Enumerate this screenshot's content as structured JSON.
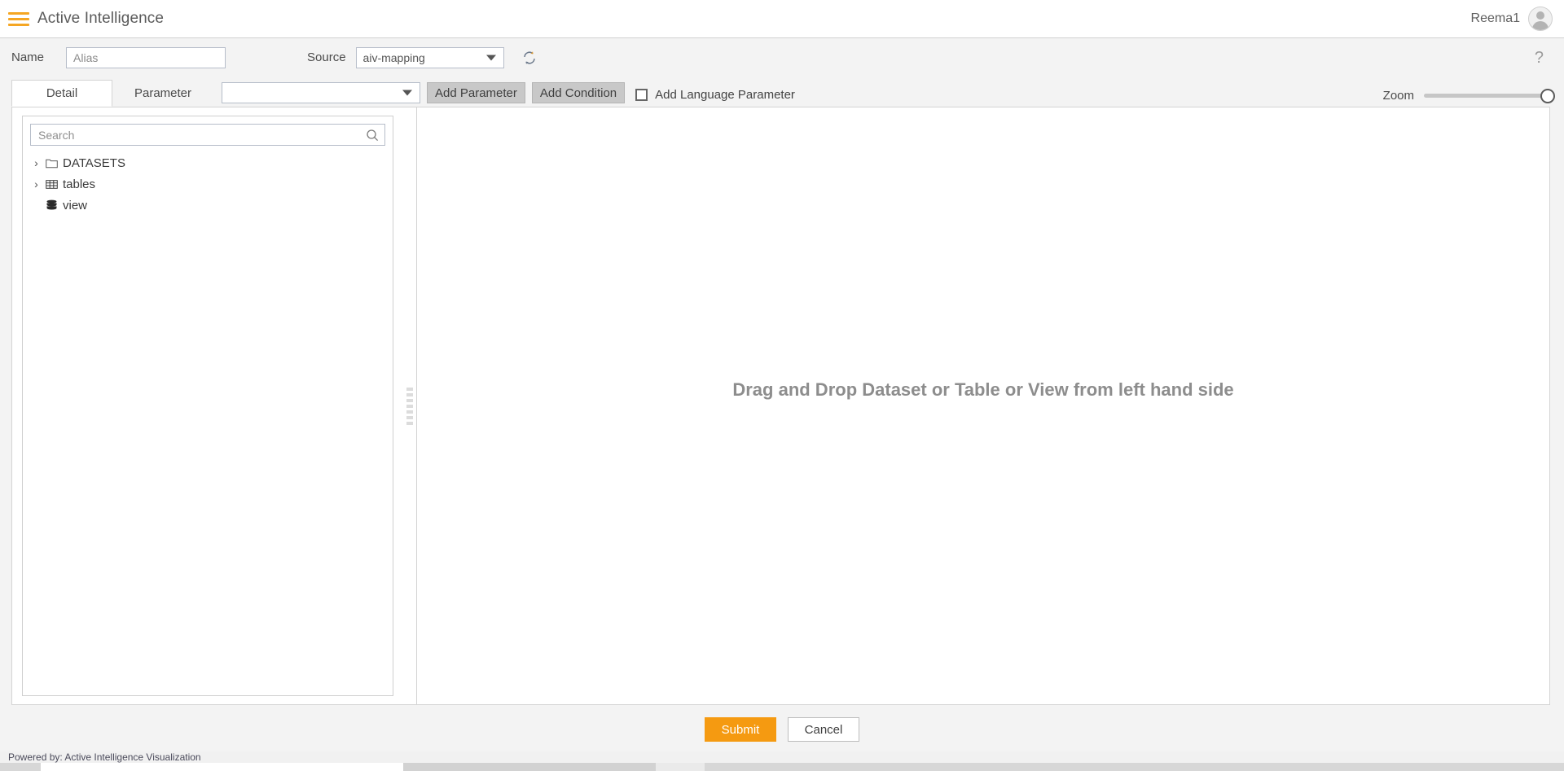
{
  "appbar": {
    "menu_icon": "hamburger-menu-icon",
    "title": "Active Intelligence",
    "user_name": "Reema1",
    "avatar_icon": "user-avatar-icon"
  },
  "namebar": {
    "name_label": "Name",
    "name_value": "",
    "name_placeholder": "Alias",
    "source_label": "Source",
    "source_value": "aiv-mapping",
    "source_options": [
      "aiv-mapping"
    ],
    "refresh_icon": "refresh-icon",
    "help_icon": "help-question-icon"
  },
  "toolbar": {
    "tabs": [
      {
        "label": "Detail",
        "active": true
      },
      {
        "label": "Parameter",
        "active": false
      }
    ],
    "parameter_select_value": "",
    "parameter_select_placeholder": "",
    "add_parameter_label": "Add Parameter",
    "add_condition_label": "Add Condition",
    "language_checkbox_label": "Add Language Parameter",
    "language_checkbox_checked": false,
    "zoom_label": "Zoom",
    "zoom_value": 100
  },
  "left_panel": {
    "search_value": "",
    "search_placeholder": "Search",
    "search_icon": "search-icon",
    "tree": [
      {
        "label": "DATASETS",
        "icon": "folder-icon",
        "expandable": true,
        "chevron": "›"
      },
      {
        "label": "tables",
        "icon": "table-grid-icon",
        "expandable": true,
        "chevron": "›"
      },
      {
        "label": "view",
        "icon": "database-stack-icon",
        "expandable": false,
        "chevron": ""
      }
    ]
  },
  "splitter": {
    "grip_icon": "drag-grip-icon"
  },
  "canvas": {
    "drop_hint": "Drag and Drop Dataset or Table or View from left hand side"
  },
  "actions": {
    "submit_label": "Submit",
    "cancel_label": "Cancel"
  },
  "footer": {
    "text": "Powered by: Active Intelligence Visualization"
  },
  "colors": {
    "accent_orange": "#f59a11",
    "page_bg": "#f3f3f3",
    "panel_bg": "#ffffff",
    "text": "#4a4a4a",
    "muted_text": "#8d8d8d",
    "border": "#d4d4d4"
  }
}
